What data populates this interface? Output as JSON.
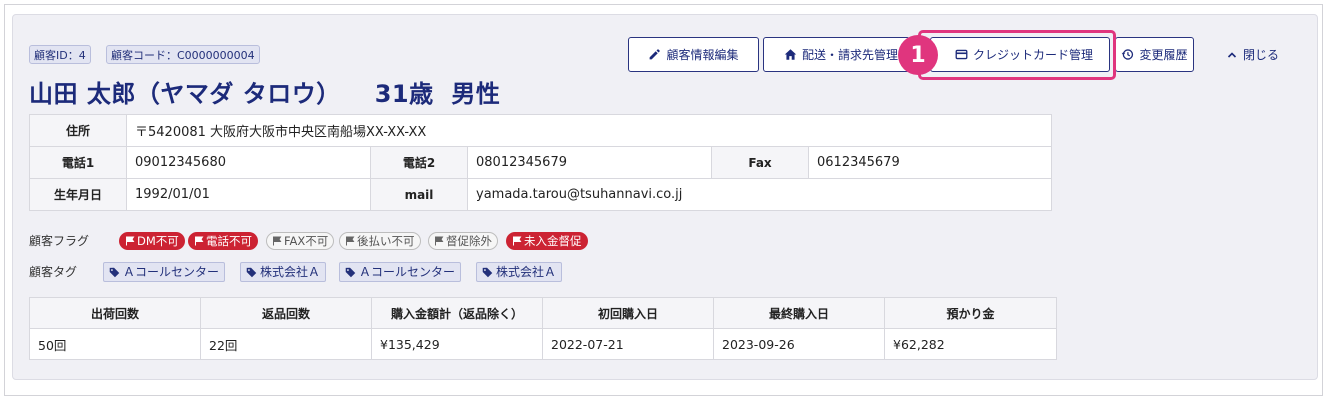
{
  "header": {
    "customer_id": "顧客ID：4",
    "customer_code": "顧客コード：C0000000004",
    "name": "山田 太郎（ヤマダ タロウ）",
    "age": "31歳",
    "gender": "男性"
  },
  "actions": {
    "edit": "顧客情報編集",
    "delivery": "配送・請求先管理",
    "credit_card": "クレジットカード管理",
    "history": "変更履歴",
    "close": "閉じる",
    "step_number": "1"
  },
  "info": {
    "address_label": "住所",
    "address_value": "〒5420081 大阪府大阪市中央区南船場XX-XX-XX",
    "phone1_label": "電話1",
    "phone1_value": "09012345680",
    "phone2_label": "電話2",
    "phone2_value": "08012345679",
    "fax_label": "Fax",
    "fax_value": "0612345679",
    "birthday_label": "生年月日",
    "birthday_value": "1992/01/01",
    "mail_label": "mail",
    "mail_value": "yamada.tarou@tsuhannavi.co.jj"
  },
  "flags": {
    "label": "顧客フラグ",
    "items": [
      {
        "label": "DM不可",
        "active": true
      },
      {
        "label": "電話不可",
        "active": true
      },
      {
        "label": "FAX不可",
        "active": false
      },
      {
        "label": "後払い不可",
        "active": false
      },
      {
        "label": "督促除外",
        "active": false
      },
      {
        "label": "未入金督促",
        "active": true
      }
    ]
  },
  "tags": {
    "label": "顧客タグ",
    "items": [
      "Ａコールセンター",
      "株式会社Ａ",
      "Ａコールセンター",
      "株式会社Ａ"
    ]
  },
  "stats": {
    "headers": [
      "出荷回数",
      "返品回数",
      "購入金額計（返品除く）",
      "初回購入日",
      "最終購入日",
      "預かり金"
    ],
    "values": [
      "50回",
      "22回",
      "¥135,429",
      "2022-07-21",
      "2023-09-26",
      "¥62,282"
    ]
  },
  "colors": {
    "accent": "#1c2a7a",
    "highlight": "#e0357e",
    "flag_active": "#cc2333"
  }
}
